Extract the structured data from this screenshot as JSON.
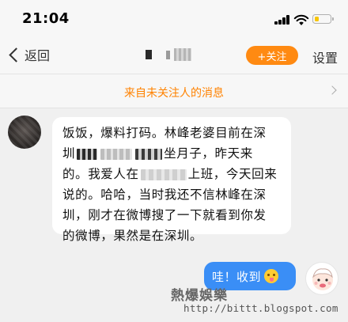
{
  "status_bar": {
    "time": "21:04",
    "battery_level": 0.3,
    "battery_color": "#f7c500"
  },
  "nav": {
    "back_label": "返回",
    "follow_label": "+关注",
    "settings_label": "设置",
    "accent_color": "#ff8a12"
  },
  "notice": {
    "text": "来自未关注人的消息"
  },
  "messages": {
    "incoming": {
      "line1": "饭饭，爆料打码。林峰老婆目前在深",
      "line2_start": "圳",
      "line2_end": "坐月子，昨天来",
      "line3_start": "的。我爱人在",
      "line3_end": "上班，今天回来",
      "line4": "说的。哈哈，当时我还不信林峰在深",
      "line5": "圳，刚才在微博搜了一下就看到你发",
      "line6": "的微博，果然是在深圳。"
    },
    "outgoing": {
      "text": "哇！收到",
      "bubble_color": "#3a8ef6"
    }
  },
  "watermark": {
    "title": "熱爆娛樂",
    "url": "http://bittt.blogspot.com"
  },
  "icons": [
    "back-chevron-icon",
    "signal-icon",
    "wifi-icon",
    "battery-icon",
    "chevron-right-icon",
    "tongue-emoji-icon"
  ]
}
